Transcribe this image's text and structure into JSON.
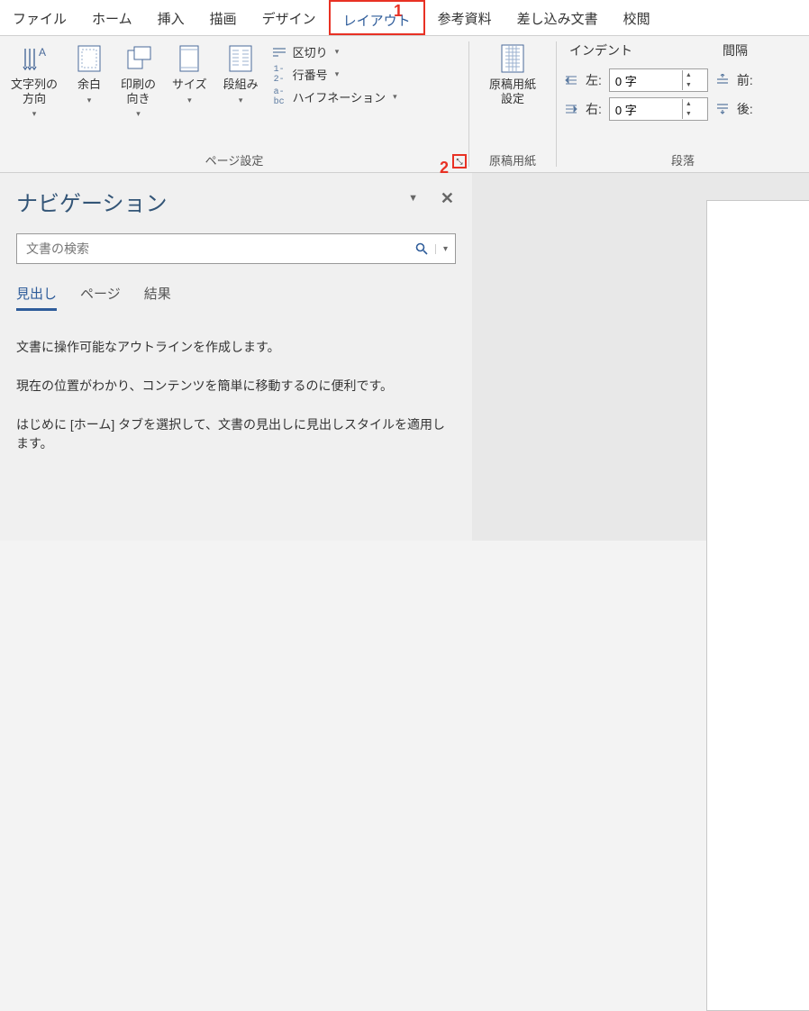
{
  "tabs": {
    "file": "ファイル",
    "home": "ホーム",
    "insert": "挿入",
    "draw": "描画",
    "design": "デザイン",
    "layout": "レイアウト",
    "references": "参考資料",
    "mailings": "差し込み文書",
    "review": "校閲"
  },
  "annotations": {
    "one": "1",
    "two": "2"
  },
  "page_setup": {
    "label": "ページ設定",
    "text_dir": "文字列の\n方向",
    "margins": "余白",
    "orientation": "印刷の\n向き",
    "size": "サイズ",
    "columns": "段組み",
    "breaks": "区切り",
    "line_numbers": "行番号",
    "hyphenation": "ハイフネーション"
  },
  "manuscript": {
    "label": "原稿用紙",
    "btn": "原稿用紙\n設定"
  },
  "paragraph": {
    "label": "段落",
    "indent": "インデント",
    "spacing": "間隔",
    "left": "左:",
    "right": "右:",
    "before": "前:",
    "after": "後:",
    "left_val": "0 字",
    "right_val": "0 字"
  },
  "nav": {
    "title": "ナビゲーション",
    "search_placeholder": "文書の検索",
    "tab_headings": "見出し",
    "tab_pages": "ページ",
    "tab_results": "結果",
    "msg1": "文書に操作可能なアウトラインを作成します。",
    "msg2": "現在の位置がわかり、コンテンツを簡単に移動するのに便利です。",
    "msg3": "はじめに [ホーム] タブを選択して、文書の見出しに見出しスタイルを適用します。"
  }
}
